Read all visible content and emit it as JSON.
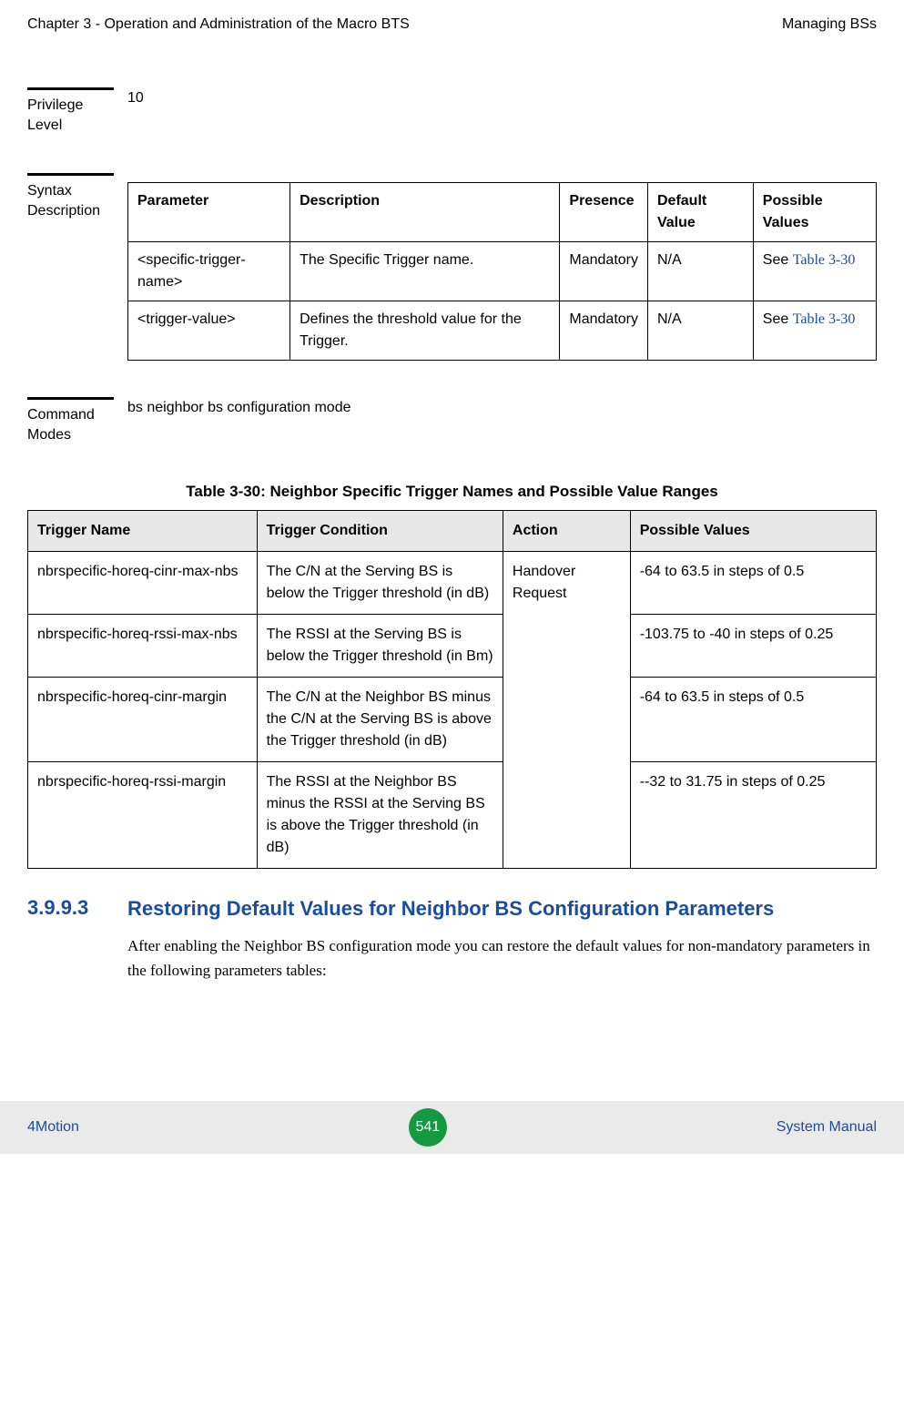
{
  "header": {
    "left": "Chapter 3 - Operation and Administration of the Macro BTS",
    "right": "Managing BSs"
  },
  "privilege": {
    "label_l1": "Privilege",
    "label_l2": "Level",
    "value": "10"
  },
  "syntax": {
    "label_l1": "Syntax",
    "label_l2": "Description",
    "headers": {
      "c1": "Parameter",
      "c2": "Description",
      "c3": "Presence",
      "c4": "Default Value",
      "c5": "Possible Values"
    },
    "rows": [
      {
        "c1": "<specific-trigger-name>",
        "c2": "The Specific Trigger name.",
        "c3": "Mandatory",
        "c4": "N/A",
        "c5_prefix": "See ",
        "c5_link": "Table 3-30"
      },
      {
        "c1": "<trigger-value>",
        "c2": "Defines the threshold value for the Trigger.",
        "c3": "Mandatory",
        "c4": "N/A",
        "c5_prefix": "See ",
        "c5_link": "Table 3-30"
      }
    ]
  },
  "command_modes": {
    "label_l1": "Command",
    "label_l2": "Modes",
    "value": "bs neighbor bs configuration mode"
  },
  "trigger_table": {
    "caption": "Table 3-30: Neighbor Specific Trigger Names and Possible Value Ranges",
    "headers": {
      "c1": "Trigger Name",
      "c2": "Trigger Condition",
      "c3": "Action",
      "c4": "Possible Values"
    },
    "action_merged": "Handover Request",
    "rows": [
      {
        "c1": "nbrspecific-horeq-cinr-max-nbs",
        "c2": "The C/N at the Serving BS is below the Trigger threshold (in dB)",
        "c4": "-64 to 63.5 in steps of 0.5"
      },
      {
        "c1": "nbrspecific-horeq-rssi-max-nbs",
        "c2": "The RSSI at the Serving BS is below the Trigger threshold (in Bm)",
        "c4": "-103.75 to -40 in steps of 0.25"
      },
      {
        "c1": "nbrspecific-horeq-cinr-margin",
        "c2": "The C/N at the Neighbor BS minus the C/N at the Serving BS is above the Trigger threshold (in dB)",
        "c4": "-64 to 63.5 in steps of 0.5"
      },
      {
        "c1": "nbrspecific-horeq-rssi-margin",
        "c2": "The RSSI at the Neighbor BS minus the RSSI at the Serving BS is above the Trigger threshold (in dB)",
        "c4": "--32 to 31.75 in steps of 0.25"
      }
    ]
  },
  "heading3": {
    "num": "3.9.9.3",
    "title": "Restoring Default Values for Neighbor BS Configuration Parameters"
  },
  "body_text": "After enabling the Neighbor BS configuration mode you can restore the default values for non-mandatory parameters in the following parameters tables:",
  "footer": {
    "left": "4Motion",
    "page": "541",
    "right": "System Manual"
  }
}
